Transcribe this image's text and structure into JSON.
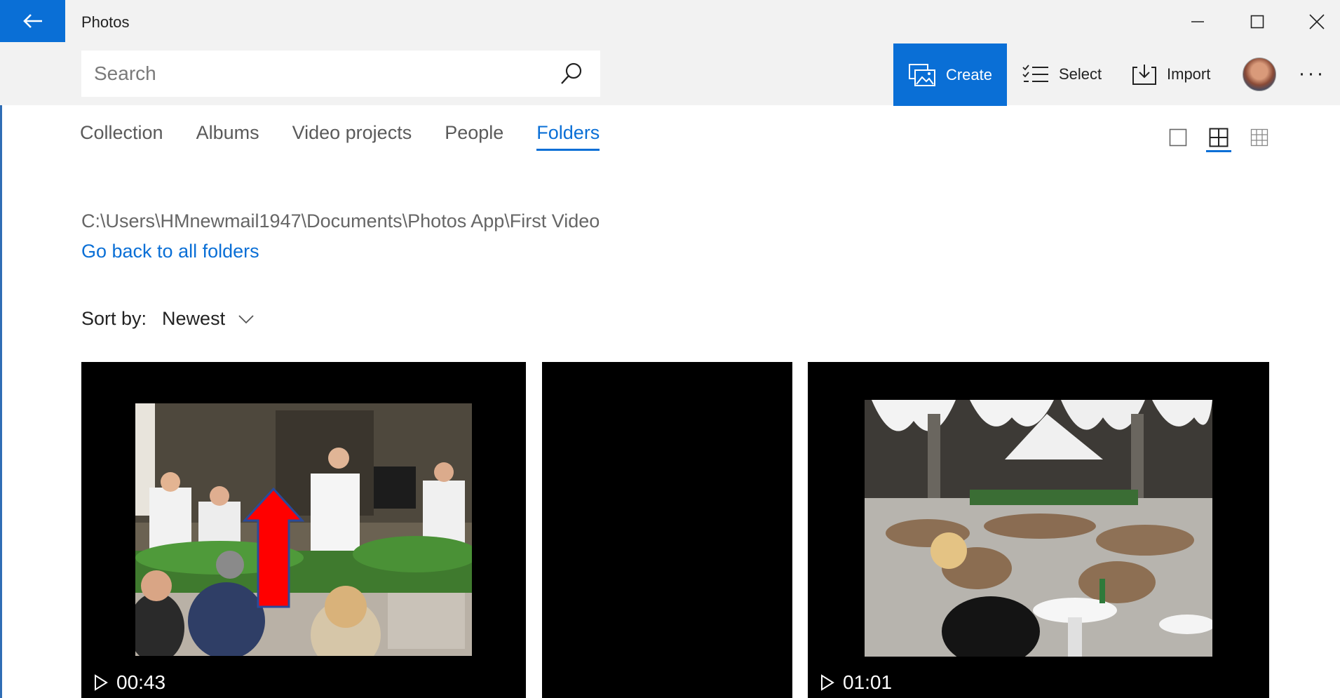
{
  "titlebar": {
    "app_title": "Photos"
  },
  "search": {
    "placeholder": "Search"
  },
  "commandbar": {
    "create_label": "Create",
    "select_label": "Select",
    "import_label": "Import",
    "more_label": "···"
  },
  "nav": {
    "tabs": [
      {
        "label": "Collection",
        "active": false
      },
      {
        "label": "Albums",
        "active": false
      },
      {
        "label": "Video projects",
        "active": false
      },
      {
        "label": "People",
        "active": false
      },
      {
        "label": "Folders",
        "active": true
      }
    ]
  },
  "folder": {
    "path": "C:\\Users\\HMnewmail1947\\Documents\\Photos App\\First Video",
    "back_link": "Go back to all folders"
  },
  "sort": {
    "label": "Sort by:",
    "value": "Newest"
  },
  "tiles": [
    {
      "duration": "00:43",
      "content": "video-thumbnail-musicians"
    },
    {
      "duration": "",
      "content": "blank"
    },
    {
      "duration": "01:01",
      "content": "video-thumbnail-cafe-square"
    }
  ],
  "colors": {
    "accent": "#0a6fd6",
    "annotation_arrow": "#ff0000"
  }
}
